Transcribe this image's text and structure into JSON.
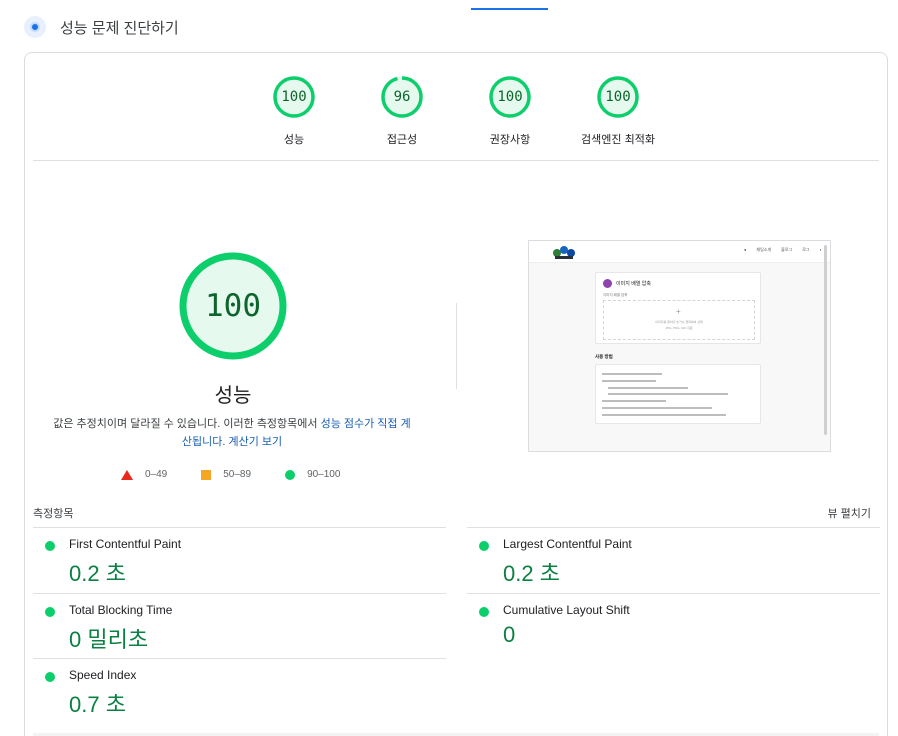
{
  "header": {
    "title": "성능 문제 진단하기",
    "icon": "lighthouse-icon"
  },
  "categories": [
    {
      "label": "성능",
      "score": "100",
      "fraction": 1.0
    },
    {
      "label": "접근성",
      "score": "96",
      "fraction": 0.96
    },
    {
      "label": "권장사항",
      "score": "100",
      "fraction": 1.0
    },
    {
      "label": "검색엔진 최적화",
      "score": "100",
      "fraction": 1.0
    }
  ],
  "performance": {
    "score": "100",
    "title": "성능",
    "desc_prefix": "값은 추정치이며 달라질 수 있습니다. 이러한 측정항목에서 ",
    "desc_link1": "성능 점수가 직접 계산됩니다",
    "desc_suffix": ". ",
    "desc_link2": "계산기 보기"
  },
  "legend": [
    {
      "range": "0–49",
      "shape": "triangle",
      "color": "#e8291c"
    },
    {
      "range": "50–89",
      "shape": "square",
      "color": "#f6a623"
    },
    {
      "range": "90–100",
      "shape": "circle",
      "color": "#0cce6b"
    }
  ],
  "metrics_section": {
    "title": "측정항목",
    "expand": "뷰 펼치기"
  },
  "metrics": [
    {
      "name": "First Contentful Paint",
      "value": "0.2 초"
    },
    {
      "name": "Largest Contentful Paint",
      "value": "0.2 초"
    },
    {
      "name": "Total Blocking Time",
      "value": "0 밀리초"
    },
    {
      "name": "Cumulative Layout Shift",
      "value": "0"
    },
    {
      "name": "Speed Index",
      "value": "0.7 초"
    }
  ],
  "screenshot": {
    "nav_links": [
      "●",
      "채팅소개",
      "블로그",
      "로그",
      "◐"
    ],
    "card_title": "이미지 배열 압축",
    "card_sub": "이미지 배열 압축",
    "drop_line1": "이미지를 끌어다 놓거나 클릭하여 선택",
    "drop_line2": "JPG, PNG, GIF 지원",
    "section_title": "사용 방법"
  },
  "colors": {
    "pass": "#0cce6b",
    "pass_text": "#0d652d",
    "accent": "#1a73e8"
  }
}
